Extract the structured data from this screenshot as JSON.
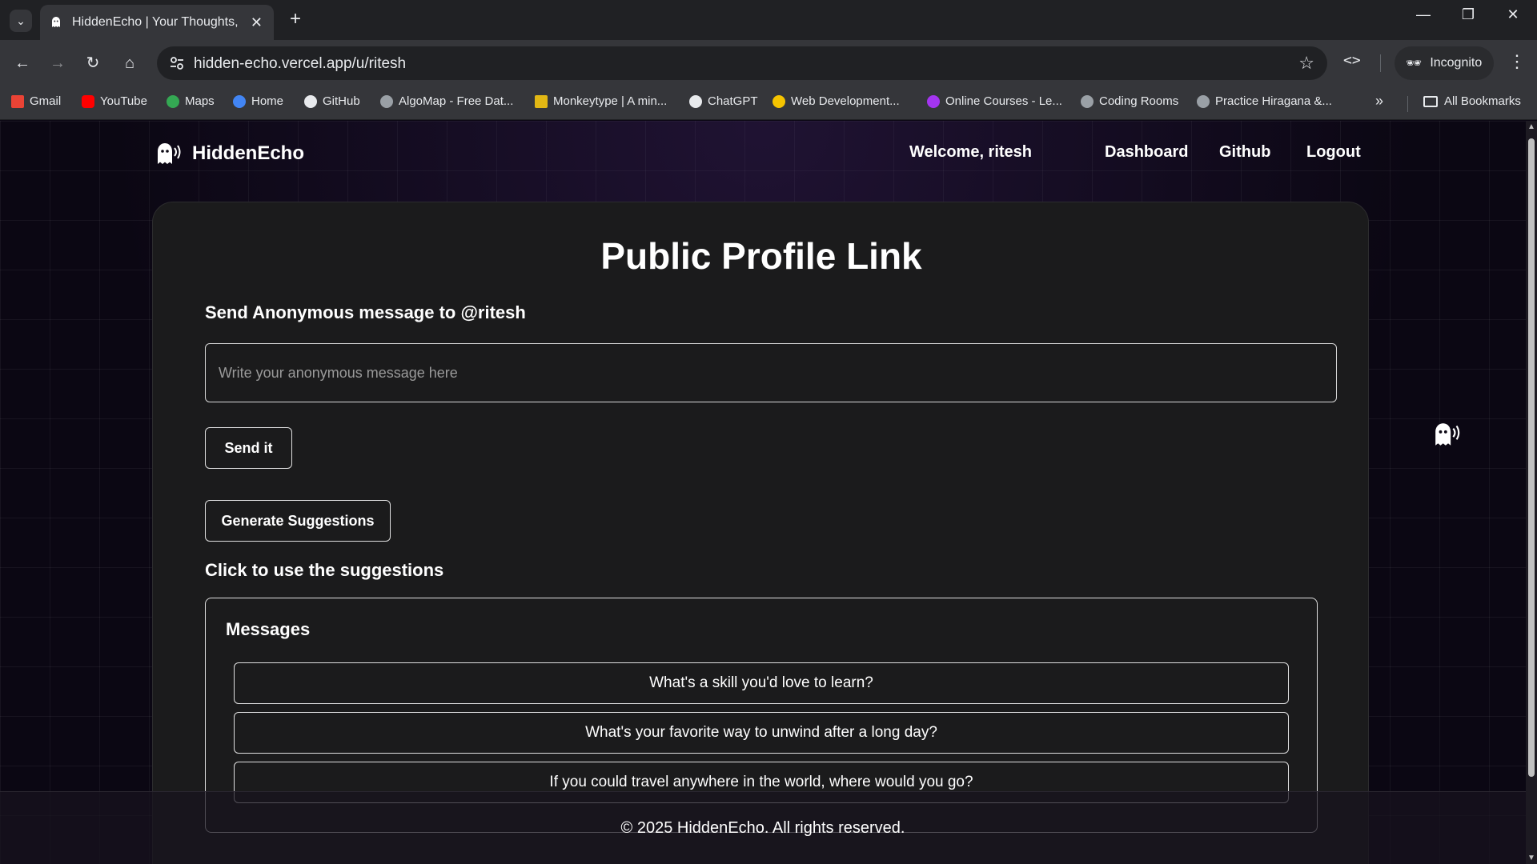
{
  "browser": {
    "tab_title": "HiddenEcho | Your Thoughts, Unheard",
    "url": "hidden-echo.vercel.app/u/ritesh",
    "incognito_label": "Incognito",
    "all_bookmarks_label": "All Bookmarks",
    "bookmarks": [
      {
        "label": "Gmail",
        "color": "#ea4335"
      },
      {
        "label": "YouTube",
        "color": "#ff0000"
      },
      {
        "label": "Maps",
        "color": "#34a853"
      },
      {
        "label": "Home",
        "color": "#4285f4"
      },
      {
        "label": "GitHub",
        "color": "#e8eaed"
      },
      {
        "label": "AlgoMap - Free Dat...",
        "color": "#9aa0a6"
      },
      {
        "label": "Monkeytype | A min...",
        "color": "#e2b714"
      },
      {
        "label": "ChatGPT",
        "color": "#e8eaed"
      },
      {
        "label": "Web Development...",
        "color": "#f5c400"
      },
      {
        "label": "Online Courses - Le...",
        "color": "#a435f0"
      },
      {
        "label": "Coding Rooms",
        "color": "#9aa0a6"
      },
      {
        "label": "Practice Hiragana &...",
        "color": "#9aa0a6"
      }
    ]
  },
  "navbar": {
    "brand": "HiddenEcho",
    "welcome": "Welcome, ritesh",
    "links": [
      "Dashboard",
      "Github",
      "Logout"
    ]
  },
  "main": {
    "title": "Public Profile Link",
    "send_label": "Send Anonymous message to @ritesh",
    "input_placeholder": "Write your anonymous message here",
    "send_button": "Send it",
    "generate_button": "Generate Suggestions",
    "suggestions_label": "Click to use the suggestions",
    "messages_heading": "Messages",
    "suggestions": [
      "What's a skill you'd love to learn?",
      "What's your favorite way to unwind after a long day?",
      "If you could travel anywhere in the world, where would you go?"
    ]
  },
  "footer": {
    "text": "© 2025 HiddenEcho. All rights reserved."
  }
}
